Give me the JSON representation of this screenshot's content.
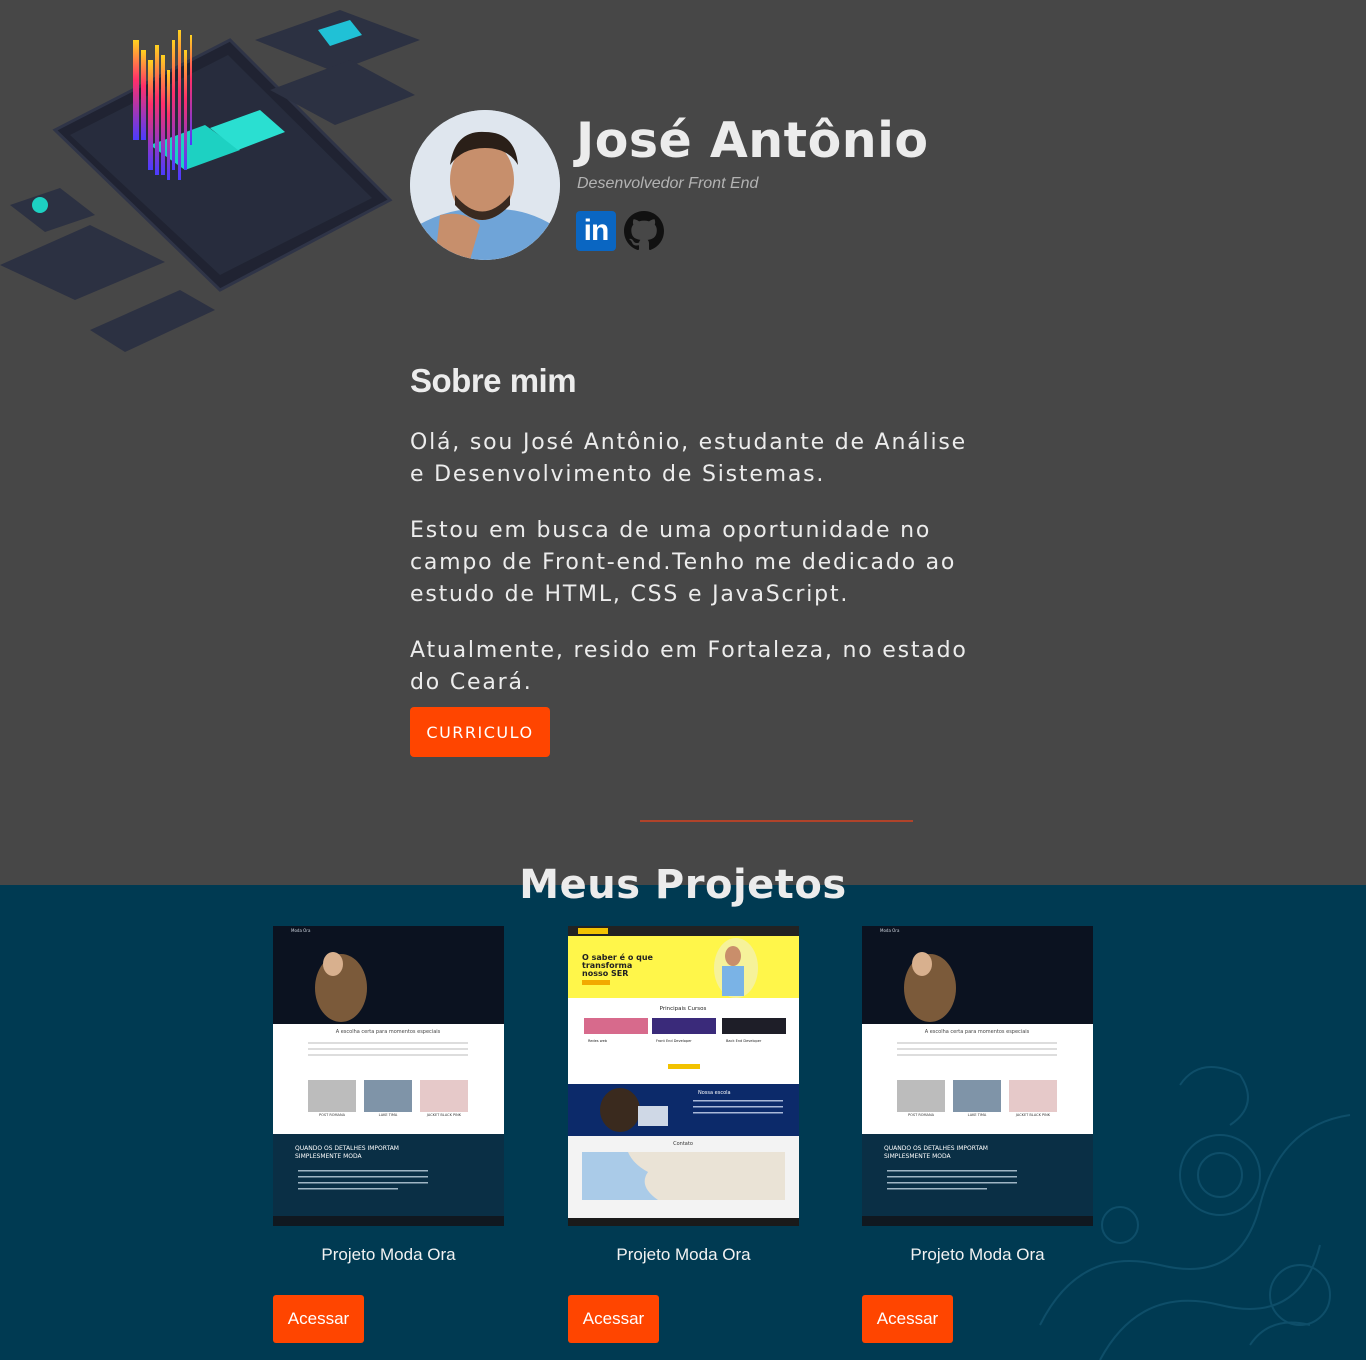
{
  "profile": {
    "name": "José Antônio",
    "role": "Desenvolvedor Front End",
    "social": {
      "linkedin_text": "in"
    }
  },
  "about": {
    "title": "Sobre mim",
    "paragraphs": [
      "Olá, sou José Antônio, estudante de Análise e Desenvolvimento de Sistemas.",
      "Estou em busca de uma oportunidade no campo de Front-end.Tenho me dedicado ao estudo de HTML, CSS e JavaScript.",
      "Atualmente, resido em Fortaleza, no estado do Ceará."
    ],
    "cv_button": "CURRICULO"
  },
  "projects": {
    "title": "Meus Projetos",
    "items": [
      {
        "title": "Projeto Moda Ora",
        "button": "Acessar"
      },
      {
        "title": "Projeto Moda Ora",
        "button": "Acessar"
      },
      {
        "title": "Projeto Moda Ora",
        "button": "Acessar"
      }
    ]
  },
  "thumbs": {
    "moda": {
      "brand": "Moda Ora",
      "tagline": "A escolha certa para momentos especiais",
      "banner_line1": "QUANDO OS DETALHES IMPORTAM",
      "banner_line2": "SIMPLESMENTE MODA",
      "products": [
        "POST ROMANA",
        "LAKE TIMA",
        "JACKET BLACK PINK"
      ]
    },
    "school": {
      "headline_1": "O saber é o que",
      "headline_2": "transforma",
      "headline_3": "nosso SER",
      "courses_title": "Principais Cursos",
      "courses": [
        "Redes web",
        "Front End Developer",
        "Back End Developer"
      ],
      "about_title": "Nossa escola",
      "contact_title": "Contato"
    }
  },
  "colors": {
    "accent": "#ff4500",
    "top_bg": "#474747",
    "projects_bg": "#003a52",
    "linkedin": "#0a66c2"
  }
}
